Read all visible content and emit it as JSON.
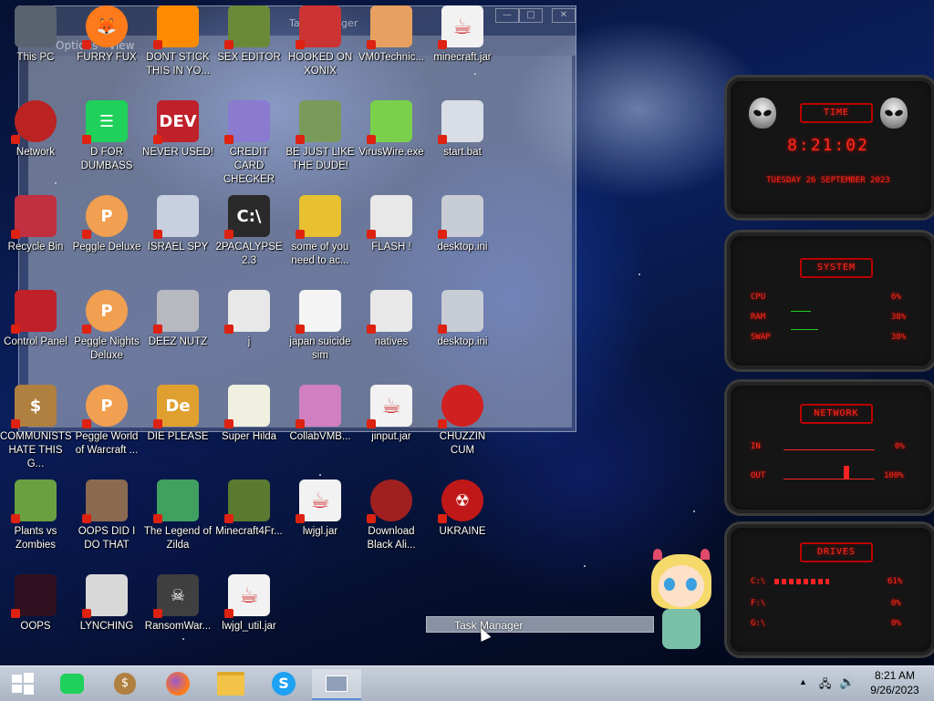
{
  "ghost_window": {
    "menu_options": "Options",
    "menu_view": "View",
    "caption": "Task Manager",
    "min": "—",
    "max": "□",
    "close": "✕"
  },
  "icons": [
    {
      "label": "This PC",
      "icon": "computer-icon"
    },
    {
      "label": "FURRY FUX",
      "icon": "firefox-icon"
    },
    {
      "label": "DONT STICK THIS IN YO...",
      "icon": "vlc-icon"
    },
    {
      "label": "SEX EDITOR",
      "icon": "hxd-icon"
    },
    {
      "label": "HOOKED ON XONIX",
      "icon": "xonix-icon"
    },
    {
      "label": "VM0Technic...",
      "icon": "doctor-icon"
    },
    {
      "label": "minecraft.jar",
      "icon": "java-icon"
    },
    {
      "label": "Network",
      "icon": "network-icon"
    },
    {
      "label": "D FOR DUMBASS",
      "icon": "chat-icon"
    },
    {
      "label": "NEVER USED!",
      "icon": "devcpp-icon"
    },
    {
      "label": "CREDIT CARD CHECKER",
      "icon": "credit-card-icon"
    },
    {
      "label": "BE JUST LIKE THE DUDE!",
      "icon": "dude-icon"
    },
    {
      "label": "VirusWire.exe",
      "icon": "lime-icon"
    },
    {
      "label": "start.bat",
      "icon": "batch-icon"
    },
    {
      "label": "Recycle Bin",
      "icon": "recycle-bin-icon"
    },
    {
      "label": "Peggle Deluxe",
      "icon": "peggle-icon"
    },
    {
      "label": "ISRAEL SPY",
      "icon": "network-share-icon"
    },
    {
      "label": "2PACALYPSE 2.3",
      "icon": "terminal-icon"
    },
    {
      "label": "some of you need to ac...",
      "icon": "cartoon-dog-icon"
    },
    {
      "label": "FLASH !",
      "icon": "file-icon"
    },
    {
      "label": "desktop.ini",
      "icon": "ini-file-icon"
    },
    {
      "label": "Control Panel",
      "icon": "control-panel-icon"
    },
    {
      "label": "Peggle Nights Deluxe",
      "icon": "peggle-icon"
    },
    {
      "label": "DEEZ NUTZ",
      "icon": "stack-icon"
    },
    {
      "label": "j",
      "icon": "file-icon"
    },
    {
      "label": "japan suicide sim",
      "icon": "document-icon"
    },
    {
      "label": "natives",
      "icon": "file-icon"
    },
    {
      "label": "desktop.ini",
      "icon": "ini-file-icon"
    },
    {
      "label": "COMMUNISTS HATE THIS G...",
      "icon": "money-bag-icon"
    },
    {
      "label": "Peggle World of Warcraft ...",
      "icon": "peggle-icon"
    },
    {
      "label": "DIE PLEASE",
      "icon": "de-icon"
    },
    {
      "label": "Super Hilda",
      "icon": "pixel-icon"
    },
    {
      "label": "CollabVMB...",
      "icon": "monitor-icon"
    },
    {
      "label": "jinput.jar",
      "icon": "java-icon"
    },
    {
      "label": "CHUZZIN CUM",
      "icon": "chuzzle-icon"
    },
    {
      "label": "Plants vs Zombies",
      "icon": "flower-icon"
    },
    {
      "label": "OOPS DID I DO THAT",
      "icon": "portrait-icon"
    },
    {
      "label": "The Legend of Zilda",
      "icon": "zelda-icon"
    },
    {
      "label": "Minecraft4Fr...",
      "icon": "grass-block-icon"
    },
    {
      "label": "lwjgl.jar",
      "icon": "java-icon"
    },
    {
      "label": "Download Black Ali...",
      "icon": "alien-icon"
    },
    {
      "label": "UKRAINE",
      "icon": "radiation-icon"
    },
    {
      "label": "OOPS",
      "icon": "dark-icon"
    },
    {
      "label": "LYNCHING",
      "icon": "gear-rope-icon"
    },
    {
      "label": "RansomWar...",
      "icon": "skull-icon"
    },
    {
      "label": "lwjgl_util.jar",
      "icon": "java-icon"
    }
  ],
  "hud": {
    "time_title": "TIME",
    "time_value": "8:21:02",
    "date_value": "TUESDAY 26 SEPTEMBER 2023",
    "system_title": "SYSTEM",
    "cpu_label": "CPU",
    "cpu_value": "6%",
    "ram_label": "RAM",
    "ram_value": "38%",
    "swap_label": "SWAP",
    "swap_value": "38%",
    "network_title": "NETWORK",
    "in_label": "IN",
    "in_value": "0%",
    "out_label": "OUT",
    "out_value": "100%",
    "drives_title": "DRIVES",
    "drive1_label": "C:\\",
    "drive1_value": "61%",
    "drive2_label": "F:\\",
    "drive2_value": "0%",
    "drive3_label": "G:\\",
    "drive3_value": "0%"
  },
  "tooltip": "Task Manager",
  "taskbar": {
    "start": "start-icon",
    "items": [
      "chat-icon",
      "money-bag-icon",
      "firefox-icon",
      "file-explorer-icon",
      "skype-icon",
      "taskmanager-icon"
    ],
    "time": "8:21 AM",
    "date": "9/26/2023"
  },
  "colors": {
    "hud_red": "#ff2a1a",
    "taskbar": "#b8c2d0"
  }
}
